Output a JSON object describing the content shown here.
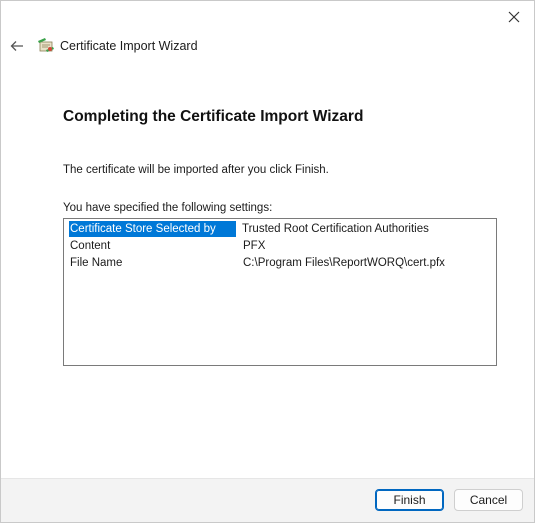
{
  "window": {
    "title": "Certificate Import Wizard",
    "close_icon": "close-icon",
    "back_icon": "back-arrow-icon",
    "app_icon": "certificate-icon"
  },
  "page": {
    "heading": "Completing the Certificate Import Wizard",
    "info": "The certificate will be imported after you click Finish.",
    "settings_label": "You have specified the following settings:"
  },
  "settings": [
    {
      "key": "Certificate Store Selected by User",
      "value": "Trusted Root Certification Authorities",
      "selected": true
    },
    {
      "key": "Content",
      "value": "PFX",
      "selected": false
    },
    {
      "key": "File Name",
      "value": "C:\\Program Files\\ReportWORQ\\cert.pfx",
      "selected": false
    }
  ],
  "footer": {
    "finish_label": "Finish",
    "cancel_label": "Cancel"
  },
  "colors": {
    "selection": "#0078d7",
    "accent_border": "#0067c0"
  }
}
